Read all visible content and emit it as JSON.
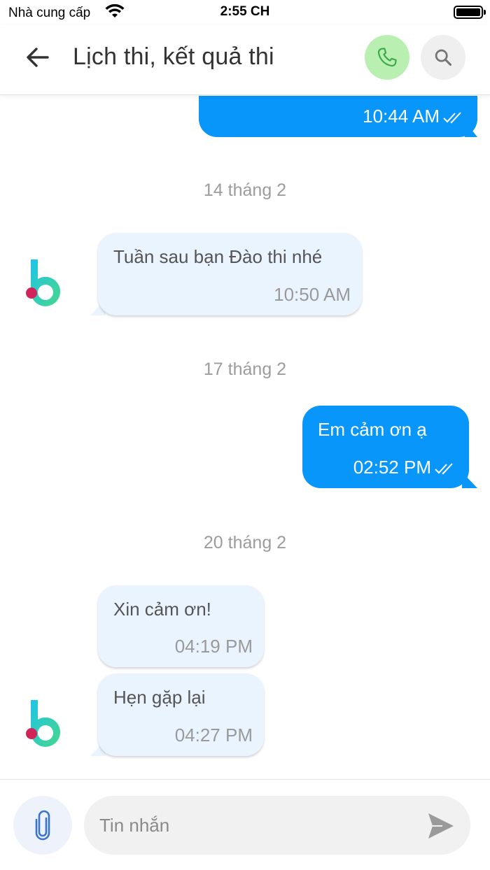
{
  "status_bar": {
    "carrier": "Nhà cung cấp",
    "time": "2:55 CH"
  },
  "header": {
    "title": "Lịch thi, kết quả thi"
  },
  "messages": [
    {
      "type": "outgoing",
      "text": "",
      "time": "10:44 AM"
    },
    {
      "type": "date",
      "text": "14 tháng 2"
    },
    {
      "type": "incoming",
      "text": "Tuần sau bạn Đào thi nhé",
      "time": "10:50 AM"
    },
    {
      "type": "date",
      "text": "17 tháng 2"
    },
    {
      "type": "outgoing",
      "text": "Em cảm ơn ạ",
      "time": "02:52 PM"
    },
    {
      "type": "date",
      "text": "20 tháng 2"
    },
    {
      "type": "incoming",
      "text": "Xin cảm ơn!",
      "time": "04:19 PM"
    },
    {
      "type": "incoming",
      "text": "Hẹn gặp lại",
      "time": "04:27 PM"
    }
  ],
  "input": {
    "placeholder": "Tin nhắn"
  },
  "colors": {
    "outgoing_bubble": "#0896fb",
    "incoming_bubble": "#eaf4ff",
    "call_button": "#b9efb0",
    "avatar_gradient_start": "#1ec4e6",
    "avatar_gradient_end": "#46d78c",
    "avatar_dot": "#d2245a"
  }
}
